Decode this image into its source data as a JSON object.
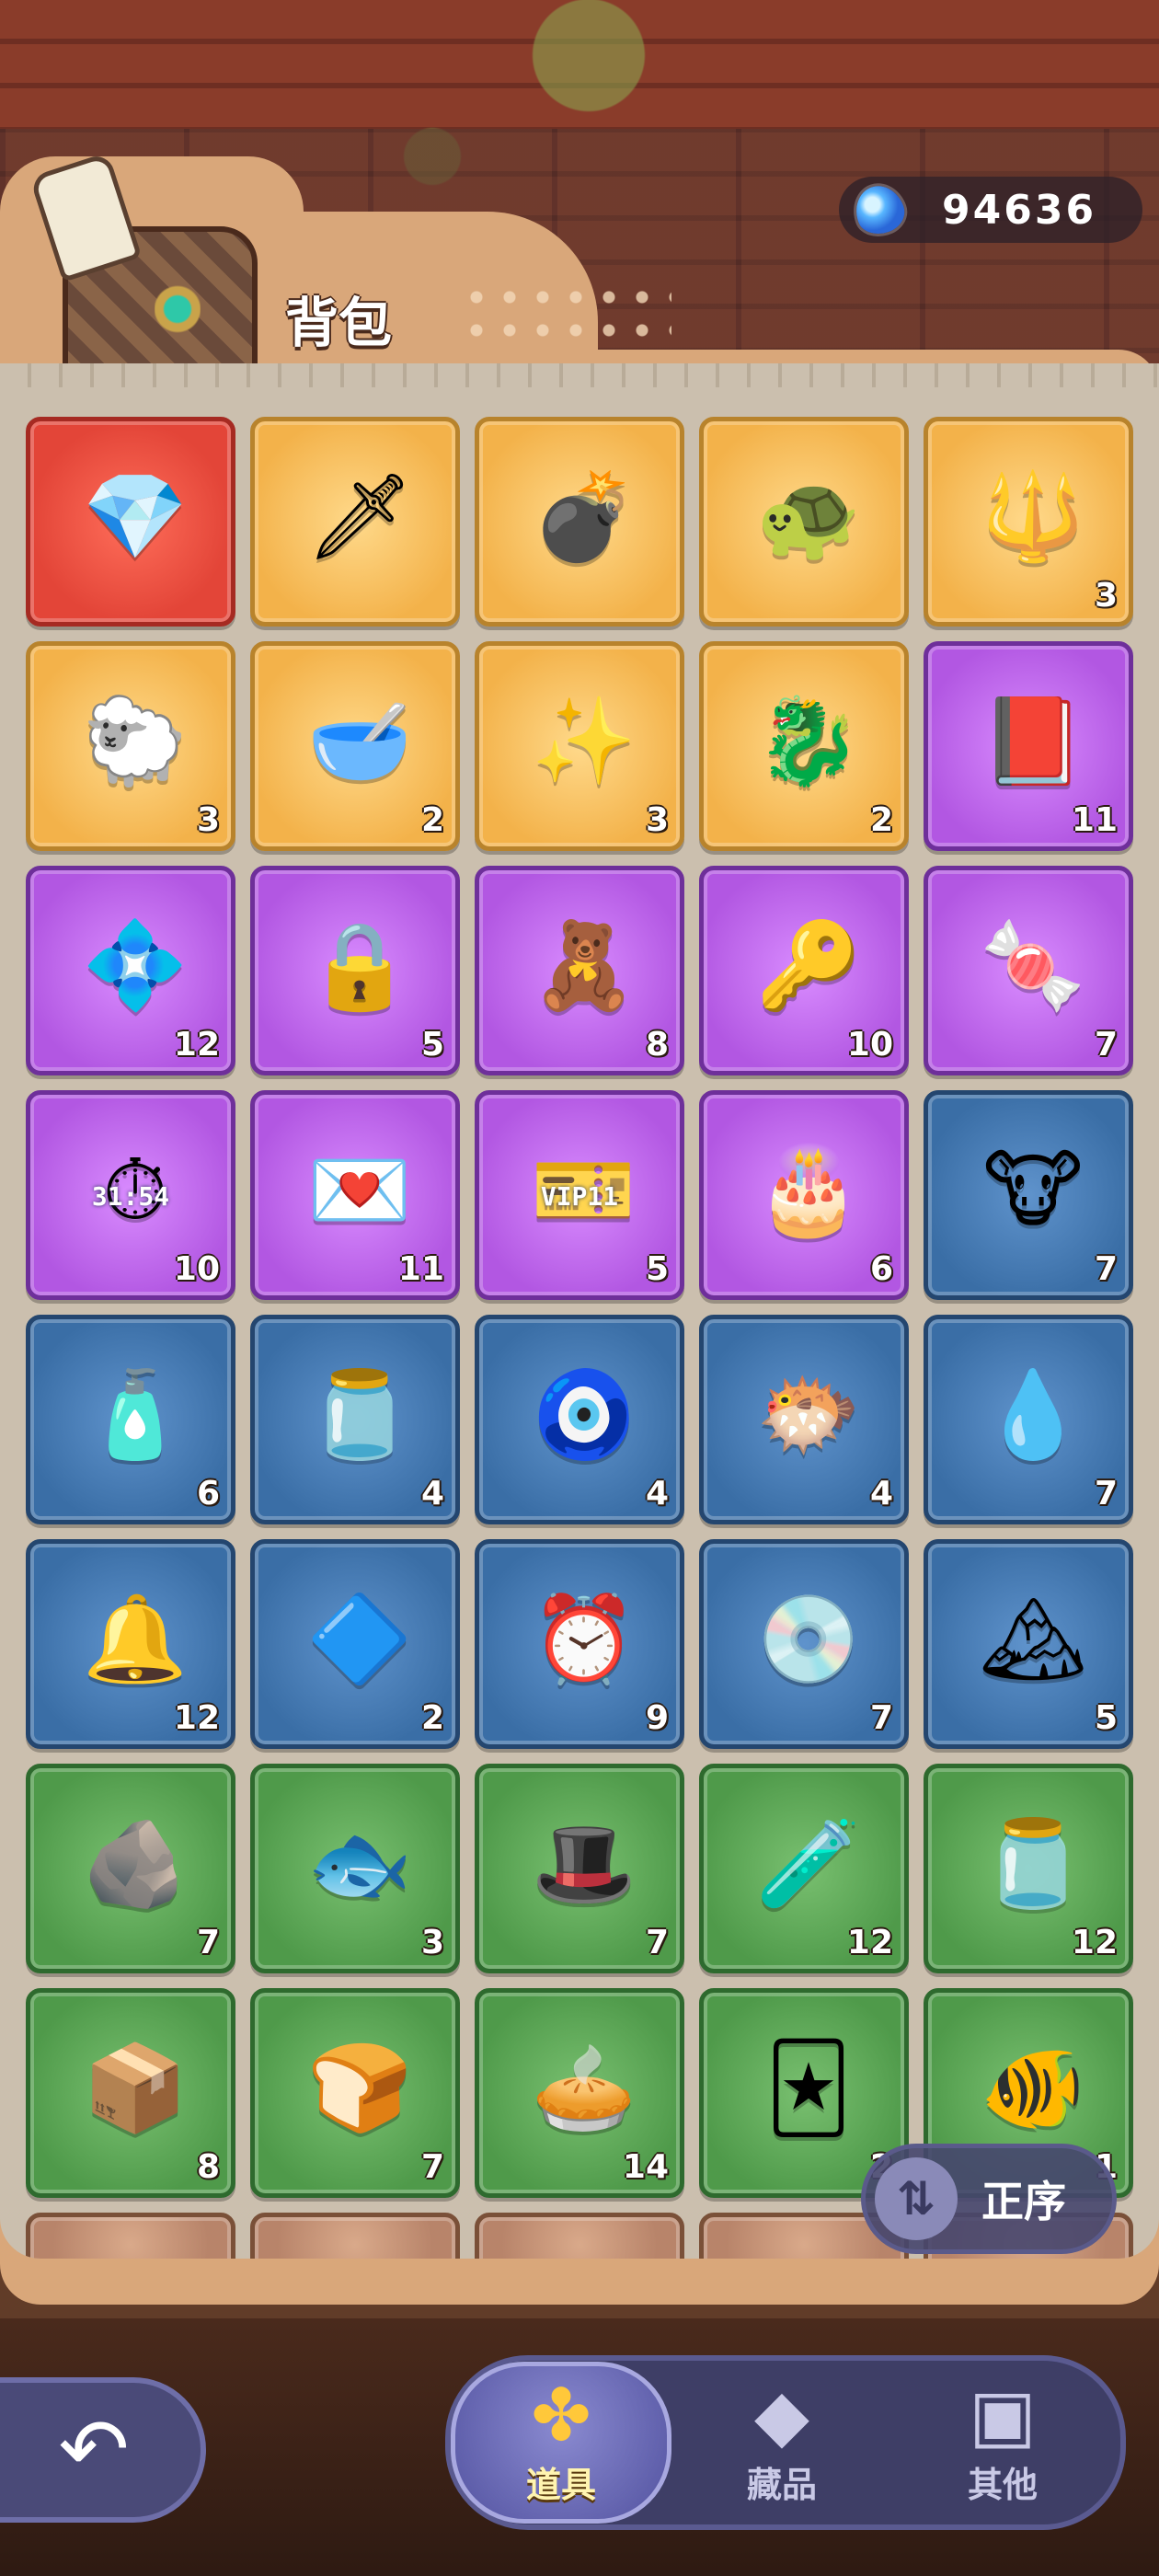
{
  "header": {
    "title": "背包"
  },
  "currency": {
    "value": "94636",
    "icon": "blue-gem-icon"
  },
  "inventory": {
    "rows": [
      [
        {
          "icon": "💎",
          "name": "blue-crystal-icon",
          "rarity": "red",
          "count": ""
        },
        {
          "icon": "🗡",
          "name": "golden-dagger-icon",
          "rarity": "gold",
          "count": ""
        },
        {
          "icon": "💣",
          "name": "star-cannon-icon",
          "rarity": "gold",
          "count": ""
        },
        {
          "icon": "🐢",
          "name": "terrarium-box-icon",
          "rarity": "gold",
          "count": ""
        },
        {
          "icon": "🔱",
          "name": "golden-trident-icon",
          "rarity": "gold",
          "count": "3"
        }
      ],
      [
        {
          "icon": "🐑",
          "name": "golden-sheep-icon",
          "rarity": "gold",
          "count": "3"
        },
        {
          "icon": "🥣",
          "name": "golden-bowl-icon",
          "rarity": "gold",
          "count": "2"
        },
        {
          "icon": "✨",
          "name": "star-potion-icon",
          "rarity": "gold",
          "count": "3"
        },
        {
          "icon": "🐉",
          "name": "golden-dragon-icon",
          "rarity": "gold",
          "count": "2"
        },
        {
          "icon": "📕",
          "name": "red-book-icon",
          "rarity": "purple",
          "count": "11"
        }
      ],
      [
        {
          "icon": "💠",
          "name": "purple-gem-icon",
          "rarity": "purple",
          "count": "12"
        },
        {
          "icon": "🔒",
          "name": "chained-lock-icon",
          "rarity": "purple",
          "count": "5"
        },
        {
          "icon": "🧸",
          "name": "teddy-bear-icon",
          "rarity": "purple",
          "count": "8"
        },
        {
          "icon": "🔑",
          "name": "silver-key-icon",
          "rarity": "purple",
          "count": "10"
        },
        {
          "icon": "🍬",
          "name": "purple-candy-icon",
          "rarity": "purple",
          "count": "7"
        }
      ],
      [
        {
          "icon": "⏱",
          "name": "stopwatch-icon",
          "rarity": "purple",
          "count": "10",
          "label": "31:54"
        },
        {
          "icon": "💌",
          "name": "love-letter-icon",
          "rarity": "purple",
          "count": "11"
        },
        {
          "icon": "🎫",
          "name": "vip-ticket-icon",
          "rarity": "purple",
          "count": "5",
          "label": "VIP11"
        },
        {
          "icon": "🎂",
          "name": "birthday-cake-icon",
          "rarity": "purple",
          "count": "6"
        },
        {
          "icon": "🐮",
          "name": "ox-figurine-icon",
          "rarity": "blue",
          "count": "7"
        }
      ],
      [
        {
          "icon": "🧴",
          "name": "blue-bottle-icon",
          "rarity": "blue",
          "count": "6"
        },
        {
          "icon": "🫙",
          "name": "potion-jar-icon",
          "rarity": "blue",
          "count": "4"
        },
        {
          "icon": "🧿",
          "name": "eye-charm-icon",
          "rarity": "blue",
          "count": "4"
        },
        {
          "icon": "🐡",
          "name": "blue-fish-icon",
          "rarity": "blue",
          "count": "4"
        },
        {
          "icon": "💧",
          "name": "water-drop-icon",
          "rarity": "blue",
          "count": "7"
        }
      ],
      [
        {
          "icon": "🔔",
          "name": "golden-bell-icon",
          "rarity": "blue",
          "count": "12"
        },
        {
          "icon": "🔷",
          "name": "white-crystal-icon",
          "rarity": "blue",
          "count": "2"
        },
        {
          "icon": "⏰",
          "name": "alarm-clock-icon",
          "rarity": "blue",
          "count": "9"
        },
        {
          "icon": "💿",
          "name": "cd-disc-icon",
          "rarity": "blue",
          "count": "7"
        },
        {
          "icon": "🏔",
          "name": "ice-crystal-icon",
          "rarity": "blue",
          "count": "5"
        }
      ],
      [
        {
          "icon": "🪨",
          "name": "rune-stone-icon",
          "rarity": "green",
          "count": "7"
        },
        {
          "icon": "🐟",
          "name": "stone-fish-icon",
          "rarity": "green",
          "count": "3"
        },
        {
          "icon": "🎩",
          "name": "green-hat-icon",
          "rarity": "green",
          "count": "7"
        },
        {
          "icon": "🧪",
          "name": "green-potion-icon",
          "rarity": "green",
          "count": "12"
        },
        {
          "icon": "🫙",
          "name": "glass-jar-icon",
          "rarity": "green",
          "count": "12"
        }
      ],
      [
        {
          "icon": "📦",
          "name": "mossy-cube-icon",
          "rarity": "green",
          "count": "8"
        },
        {
          "icon": "🍞",
          "name": "melon-bun-icon",
          "rarity": "green",
          "count": "7"
        },
        {
          "icon": "🥧",
          "name": "fruit-pie-icon",
          "rarity": "green",
          "count": "14"
        },
        {
          "icon": "🃏",
          "name": "blue-card-icon",
          "rarity": "green",
          "count": "2"
        },
        {
          "icon": "🐠",
          "name": "taiyaki-icon",
          "rarity": "green",
          "count": "1"
        }
      ]
    ],
    "partial_row": [
      "brown",
      "brown",
      "brown",
      "brown",
      "brown"
    ]
  },
  "sort": {
    "label": "正序",
    "icon": "sort-arrows-icon"
  },
  "nav": {
    "back_icon": "back-arrow-icon",
    "tabs": [
      {
        "label": "道具",
        "icon": "clover-icon",
        "active": true
      },
      {
        "label": "藏品",
        "icon": "diamond-icon",
        "active": false
      },
      {
        "label": "其他",
        "icon": "box-icon",
        "active": false
      }
    ]
  }
}
